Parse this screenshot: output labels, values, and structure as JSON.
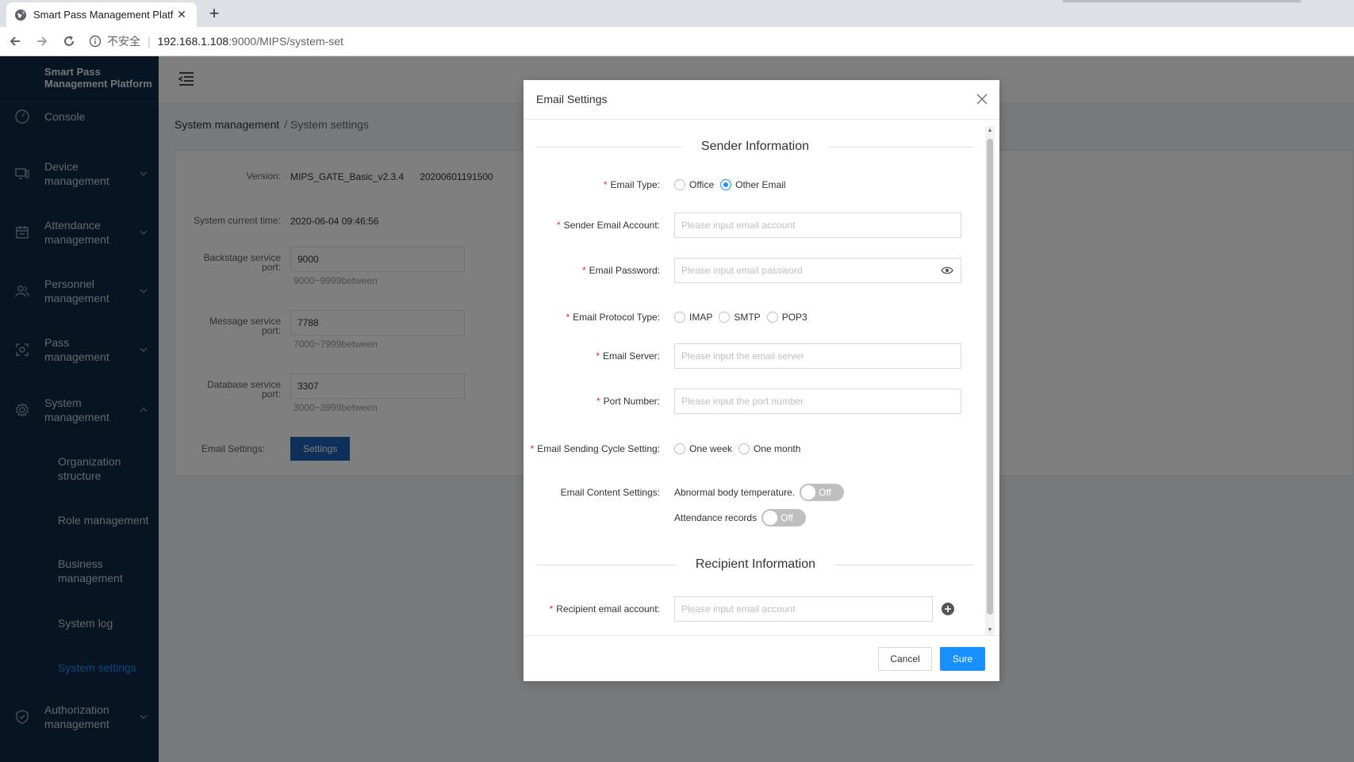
{
  "browser": {
    "tab_title": "Smart Pass Management Platf",
    "insecure_label": "不安全",
    "url_host": "192.168.1.108",
    "url_path": ":9000/MIPS/system-set"
  },
  "sidebar": {
    "brand_line1": "Smart Pass",
    "brand_line2": "Management Platform",
    "items": [
      {
        "label": "Console",
        "icon": "dashboard-icon"
      },
      {
        "label1": "Device",
        "label2": "management",
        "icon": "monitor-icon"
      },
      {
        "label1": "Attendance",
        "label2": "management",
        "icon": "calendar-icon"
      },
      {
        "label1": "Personnel",
        "label2": "management",
        "icon": "users-icon"
      },
      {
        "label1": "Pass",
        "label2": "management",
        "icon": "face-scan-icon"
      },
      {
        "label1": "System",
        "label2": "management",
        "icon": "gear-icon"
      },
      {
        "label1": "Authorization",
        "label2": "management",
        "icon": "shield-icon"
      }
    ],
    "sub_items": [
      {
        "label1": "Organization",
        "label2": "structure"
      },
      {
        "label": "Role management"
      },
      {
        "label1": "Business",
        "label2": "management"
      },
      {
        "label": "System log"
      },
      {
        "label": "System settings"
      }
    ]
  },
  "breadcrumb": {
    "level1": "System management",
    "level2": "/ System settings"
  },
  "system": {
    "version_label": "Version:",
    "version_value": "MIPS_GATE_Basic_v2.3.4",
    "version_build": "20200601191500",
    "time_label": "System current time:",
    "time_value": "2020-06-04 09:46:56",
    "backstage_label1": "Backstage service",
    "backstage_label2": "port:",
    "backstage_value": "9000",
    "backstage_hint": "9000~9999between",
    "message_label1": "Message service",
    "message_label2": "port:",
    "message_value": "7788",
    "message_hint": "7000~7999between",
    "database_label1": "Database service",
    "database_label2": "port:",
    "database_value": "3307",
    "database_hint": "3000~3999between",
    "email_label": "Email Settings:",
    "settings_button": "Settings"
  },
  "modal": {
    "title": "Email Settings",
    "sender_section": "Sender Information",
    "recipient_section": "Recipient Information",
    "email_type_label": "Email Type:",
    "email_type_options": [
      "Office",
      "Other Email"
    ],
    "email_type_selected": "Other Email",
    "sender_account_label": "Sender Email Account:",
    "sender_account_placeholder": "Please input email account",
    "password_label": "Email Password:",
    "password_placeholder": "Please input email password",
    "protocol_label": "Email Protocol Type:",
    "protocol_options": [
      "IMAP",
      "SMTP",
      "POP3"
    ],
    "server_label": "Email Server:",
    "server_placeholder": "Please input the email server",
    "port_label": "Port Number:",
    "port_placeholder": "Please input the port number",
    "cycle_label": "Email Sending Cycle Setting:",
    "cycle_options": [
      "One week",
      "One month"
    ],
    "content_label": "Email Content Settings:",
    "abnormal_label": "Abnormal body temperature.",
    "abnormal_state": "Off",
    "attendance_label": "Attendance records",
    "attendance_state": "Off",
    "recipient_label": "Recipient email account:",
    "recipient_placeholder": "Please input email account",
    "cancel": "Cancel",
    "sure": "Sure"
  },
  "colors": {
    "sidebar_bg": "#0e2943",
    "primary": "#1890ff",
    "required": "#f5222d",
    "settings_button": "#1a5fb4"
  }
}
